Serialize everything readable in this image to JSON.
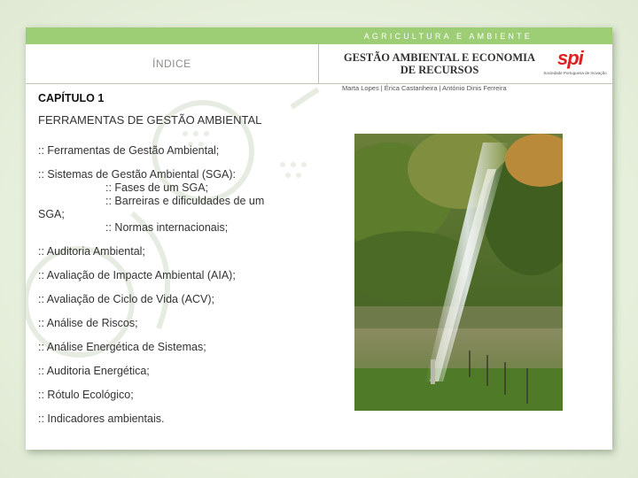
{
  "header": {
    "banner": "AGRICULTURA E AMBIENTE",
    "index_title": "ÍNDICE",
    "book_title_line1": "GESTÃO AMBIENTAL E ECONOMIA",
    "book_title_line2": "DE RECURSOS",
    "logo_mark": "spi",
    "logo_caption": "Sociedade Portuguesa de Inovação",
    "authors": "Marta Lopes | Érica Castanheira | António Dinis Ferreira"
  },
  "chapter": {
    "label": "CAPÍTULO 1",
    "title": "FERRAMENTAS DE GESTÃO AMBIENTAL"
  },
  "toc": {
    "item1": ":: Ferramentas de Gestão Ambiental;",
    "item2": ":: Sistemas de Gestão Ambiental (SGA):",
    "item2_sub1": ":: Fases de um SGA;",
    "item2_sub2a": ":: Barreiras e dificuldades de um",
    "item2_sub2b": "SGA;",
    "item2_sub3": ":: Normas internacionais;",
    "item3": ":: Auditoria Ambiental;",
    "item4": ":: Avaliação de Impacte Ambiental (AIA);",
    "item5": ":: Avaliação de Ciclo de Vida (ACV);",
    "item6": ":: Análise de Riscos;",
    "item7": ":: Análise Energética de Sistemas;",
    "item8": ":: Auditoria Energética;",
    "item9": ":: Rótulo Ecológico;",
    "item10": ":: Indicadores ambientais."
  },
  "photo": {
    "icon": "irrigation-sprinkler-photo"
  },
  "colors": {
    "banner": "#9dcd74",
    "logo": "#e02020"
  }
}
